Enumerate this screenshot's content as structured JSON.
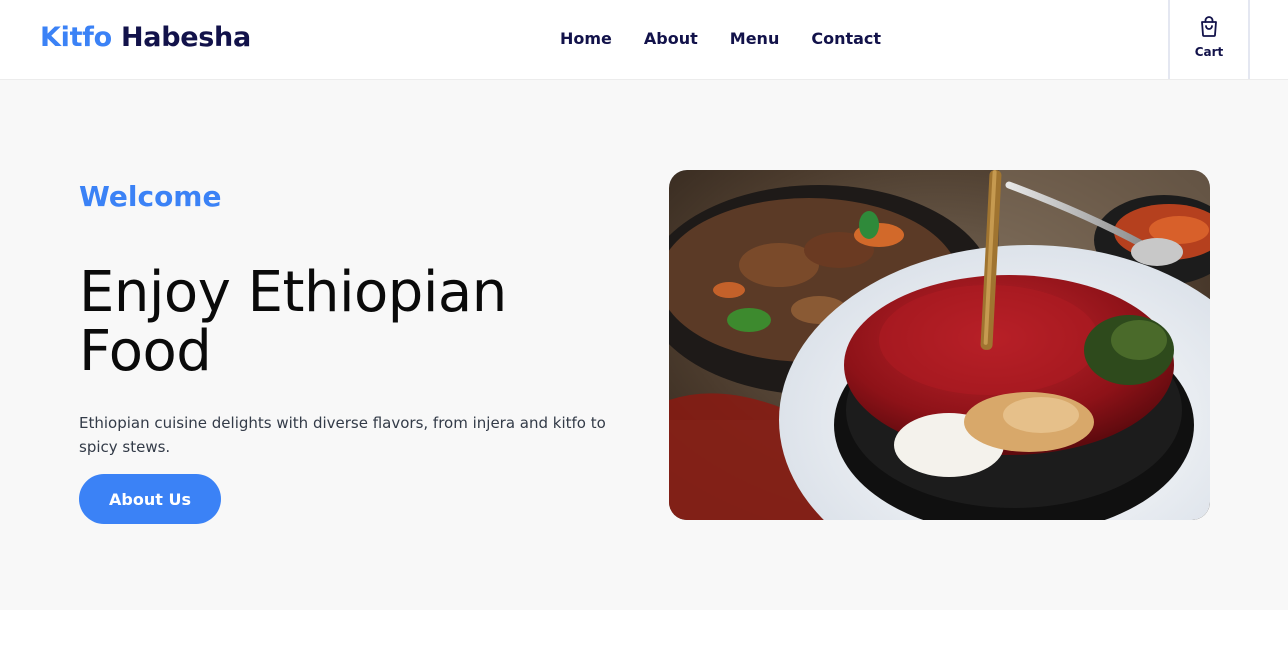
{
  "brand": {
    "name_part1": "Kitfo",
    "name_part2": "Habesha"
  },
  "nav": {
    "items": [
      {
        "label": "Home"
      },
      {
        "label": "About"
      },
      {
        "label": "Menu"
      },
      {
        "label": "Contact"
      }
    ]
  },
  "cart": {
    "label": "Cart",
    "icon": "shopping-bag-icon"
  },
  "hero": {
    "eyebrow": "Welcome",
    "title": "Enjoy Ethiopian Food",
    "description": "Ethiopian cuisine delights with diverse flavors, from injera and kitfo to spicy stews.",
    "button_label": "About Us",
    "image_alt": "Kitfo dish"
  },
  "colors": {
    "accent": "#3b82f6",
    "brand_dark": "#12124a",
    "hero_bg": "#f8f8f8"
  }
}
